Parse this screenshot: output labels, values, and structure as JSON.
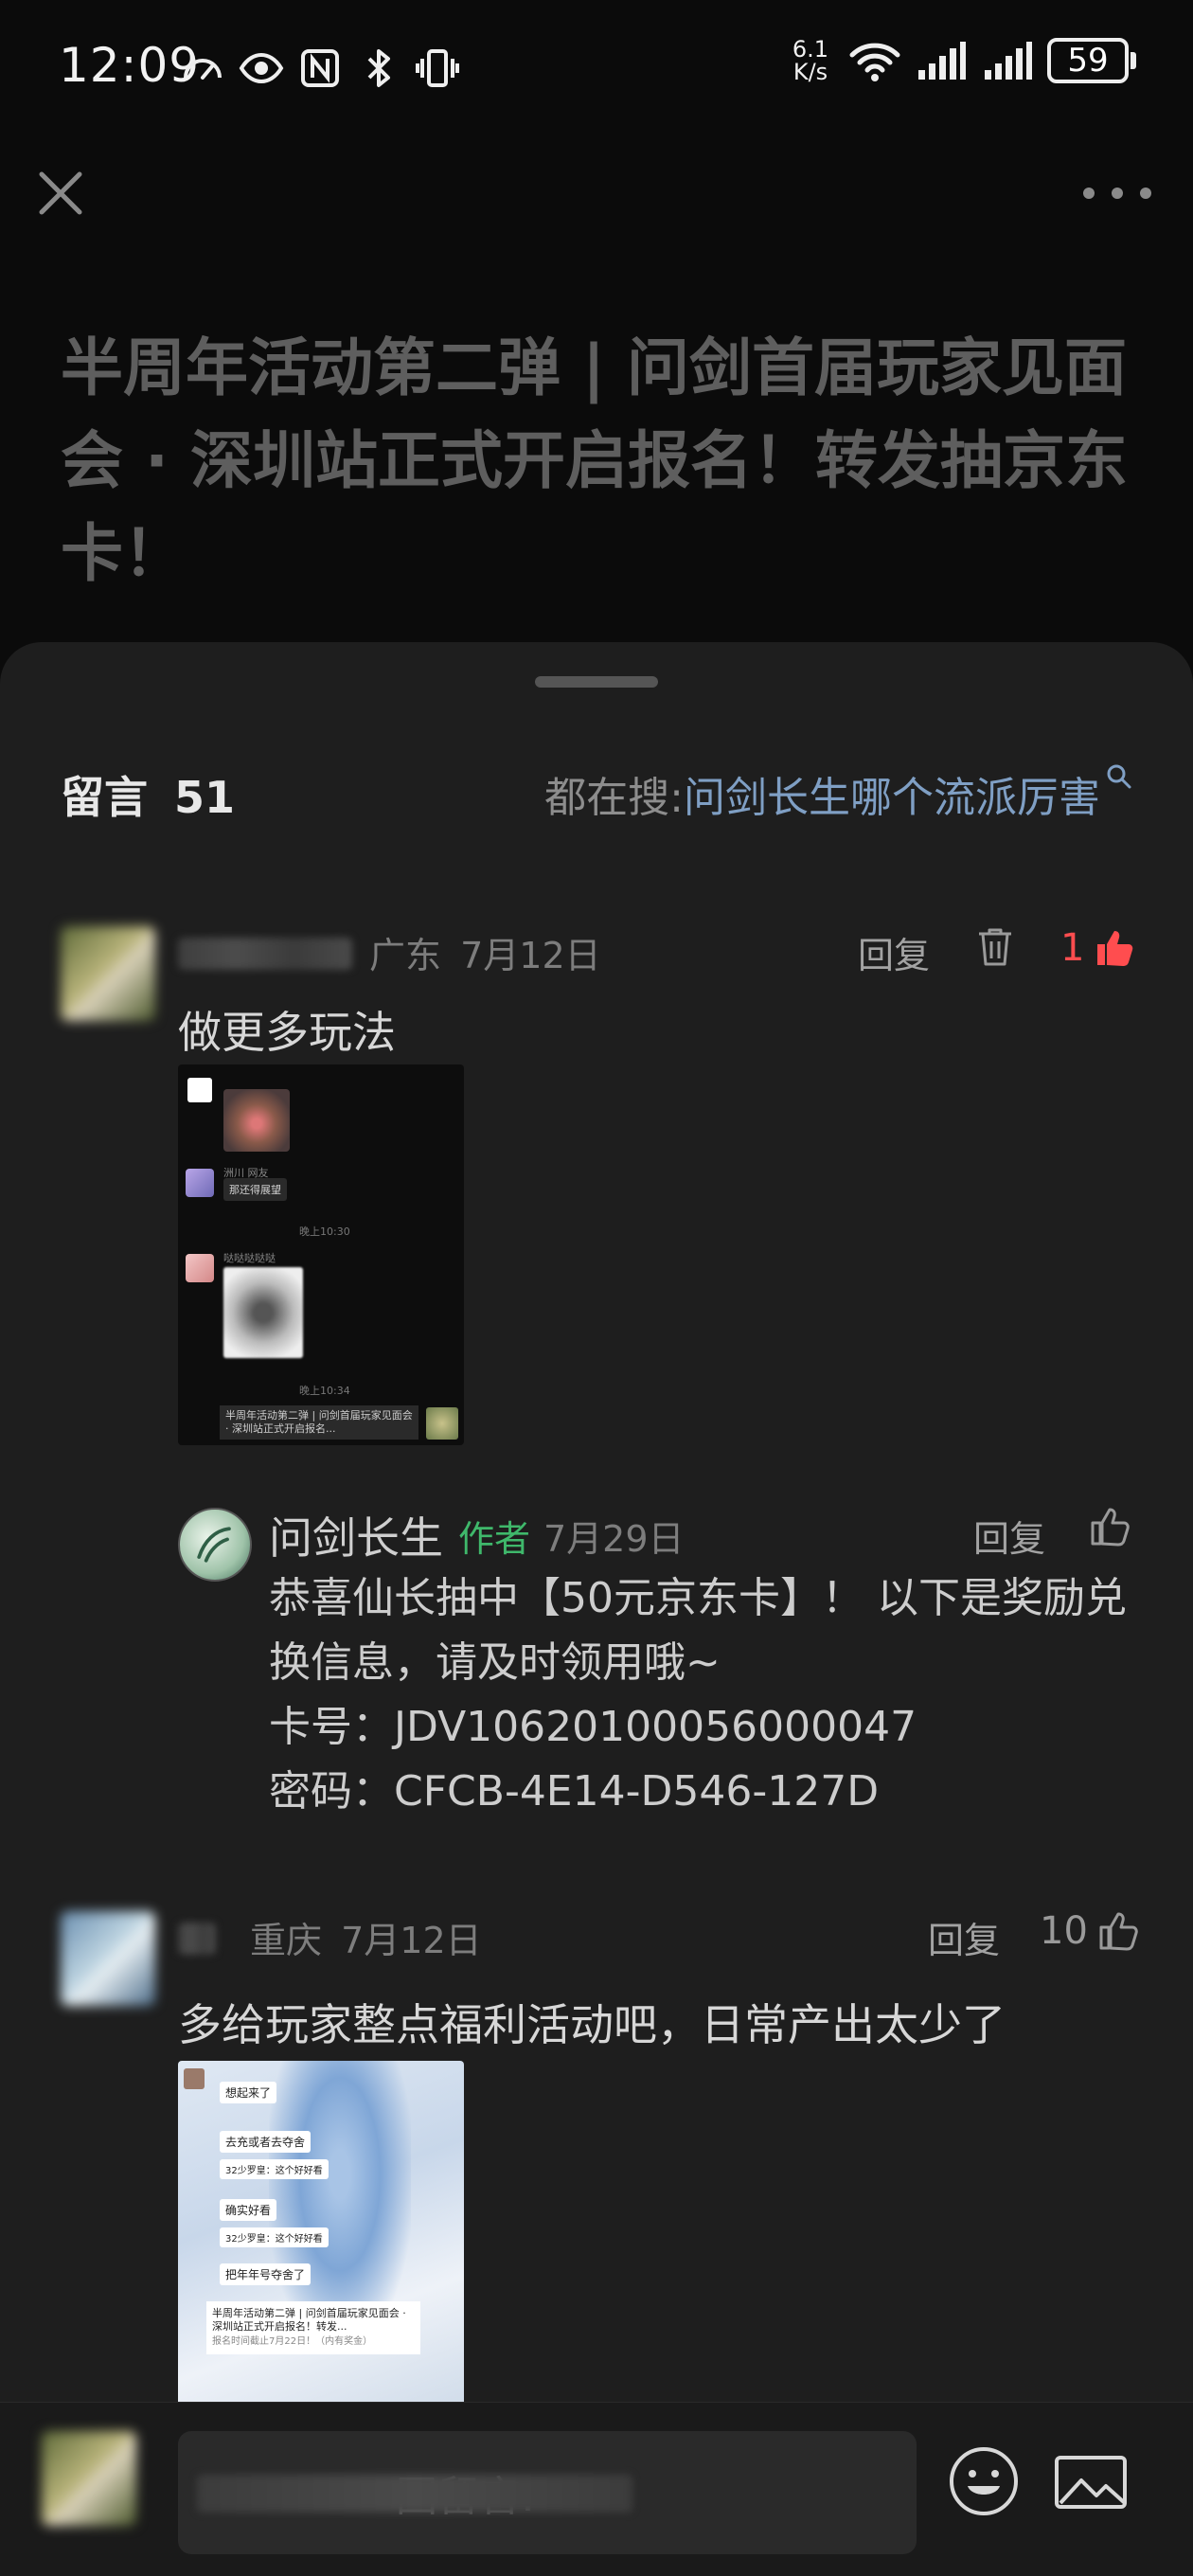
{
  "status_bar": {
    "time": "12:09",
    "net_speed_value": "6.1",
    "net_speed_unit": "K/s",
    "battery": "59"
  },
  "article": {
    "title": "半周年活动第二弹 | 问剑首届玩家见面会 · 深圳站正式开启报名！转发抽京东卡！"
  },
  "comments_header": {
    "label": "留言",
    "count": "51",
    "search_prefix": "都在搜:",
    "search_term": "问剑长生哪个流派厉害"
  },
  "comments": [
    {
      "location": "广东",
      "date": "7月12日",
      "reply_label": "回复",
      "likes": "1",
      "text": "做更多玩法",
      "thumb": {
        "sender_a": "洲川 网友",
        "bubble_a": "那还得展望",
        "time_a": "晚上10:30",
        "sender_b": "哒哒哒哒哒",
        "time_b": "晚上10:34",
        "card_text": "半周年活动第二弹 | 问剑首届玩家见面会 · 深圳站正式开启报名..."
      },
      "author_reply": {
        "name": "问剑长生",
        "tag": "作者",
        "date": "7月29日",
        "reply_label": "回复",
        "line1": "恭喜仙长抽中【50元京东卡】！ 以下是奖励兑换信息，请及时领用哦~",
        "card_no": "卡号：JDV10620100056000047",
        "password": "密码：CFCB-4E14-D546-127D"
      }
    },
    {
      "location": "重庆",
      "date": "7月12日",
      "reply_label": "回复",
      "likes": "10",
      "text": "多给玩家整点福利活动吧，日常产出太少了",
      "thumb": {
        "b1": "想起来了",
        "b2": "去充或者去夺舍",
        "b3": "32少罗皇：这个好好看",
        "b4": "确实好看",
        "b5": "32少罗皇：这个好好看",
        "b6": "把年年号夺舍了",
        "card_text": "半周年活动第二弹 | 问剑首届玩家见面会 · 深圳站正式开启报名！转发...",
        "card_sub": "报名时间截止7月22日！（内有奖金）"
      }
    }
  ],
  "input": {
    "placeholder": "回留言:"
  },
  "colors": {
    "like_active": "#ff4d4f",
    "author_tag": "#3fb86b",
    "search_term": "#7f9fc4"
  }
}
